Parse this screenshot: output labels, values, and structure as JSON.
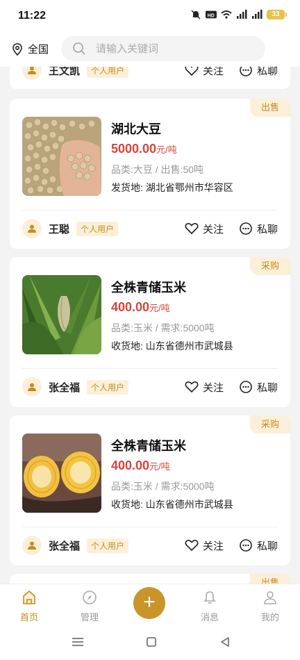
{
  "status": {
    "time": "11:22",
    "battery": "33"
  },
  "header": {
    "location": "全国",
    "search_placeholder": "请输入关键词"
  },
  "colors": {
    "accent": "#c9952b",
    "tag_bg": "#fcefd9",
    "price": "#d7443a"
  },
  "feed": {
    "partial_top": {
      "user": "王文凯",
      "badge": "个人用户",
      "follow": "关注",
      "chat": "私聊"
    },
    "cards": [
      {
        "tag": "出售",
        "title": "湖北大豆",
        "price": "5000.00",
        "unit": "元/吨",
        "meta": "品类:大豆 / 出售:50吨",
        "addr": "发货地: 湖北省鄂州市华容区",
        "user": "王聪",
        "badge": "个人用户",
        "follow": "关注",
        "chat": "私聊",
        "image": "soybeans"
      },
      {
        "tag": "采购",
        "title": "全株青储玉米",
        "price": "400.00",
        "unit": "元/吨",
        "meta": "品类:玉米 / 需求:5000吨",
        "addr": "收货地: 山东省德州市武城县",
        "user": "张全福",
        "badge": "个人用户",
        "follow": "关注",
        "chat": "私聊",
        "image": "corn-field"
      },
      {
        "tag": "采购",
        "title": "全株青储玉米",
        "price": "400.00",
        "unit": "元/吨",
        "meta": "品类:玉米 / 需求:5000吨",
        "addr": "收货地: 山东省德州市武城县",
        "user": "张全福",
        "badge": "个人用户",
        "follow": "关注",
        "chat": "私聊",
        "image": "corn-cob"
      }
    ],
    "partial_bottom_tag": "出售"
  },
  "nav": {
    "home": "首页",
    "manage": "管理",
    "add": "+",
    "messages": "消息",
    "mine": "我的"
  }
}
